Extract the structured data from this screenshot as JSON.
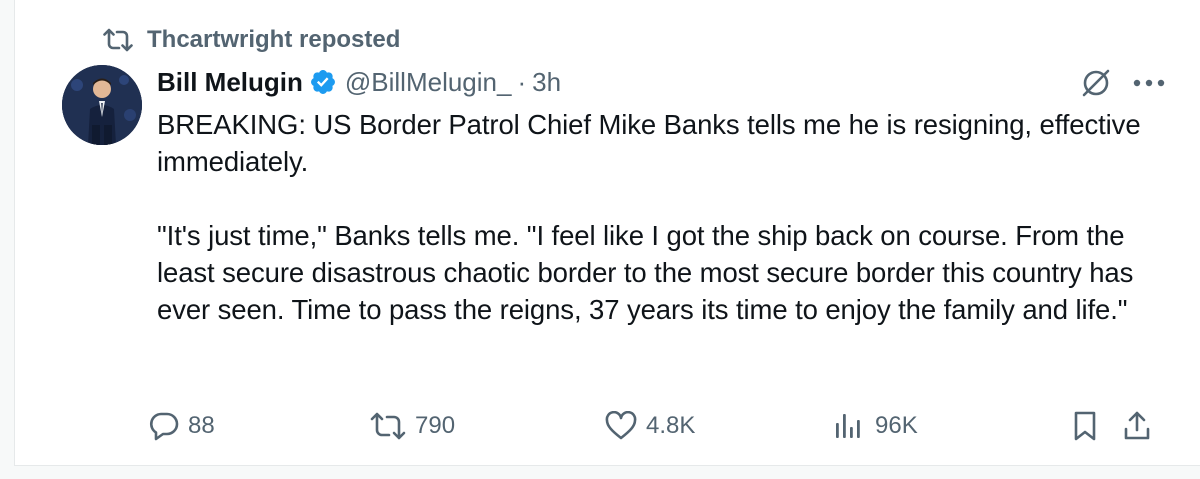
{
  "repost": {
    "icon": "repost-icon",
    "label": "Thcartwright reposted"
  },
  "post": {
    "author": {
      "display_name": "Bill Melugin",
      "verified_icon": "verified-badge-icon",
      "handle": "@BillMelugin_",
      "separator": "·",
      "time": "3h"
    },
    "text": "BREAKING: US Border Patrol Chief Mike Banks tells me he is resigning, effective immediately.\n\n\"It's just time,\" Banks tells me. \"I feel like I got the ship back on course. From the least secure disastrous chaotic border to the most secure border this country has ever seen. Time to pass the reigns, 37 years its time to enjoy the family and life.\"",
    "actions": {
      "replies": "88",
      "reposts": "790",
      "likes": "4.8K",
      "views": "96K"
    }
  },
  "colors": {
    "text": "#0f1419",
    "muted": "#536471",
    "verified": "#1d9bf0",
    "background": "#ffffff"
  }
}
